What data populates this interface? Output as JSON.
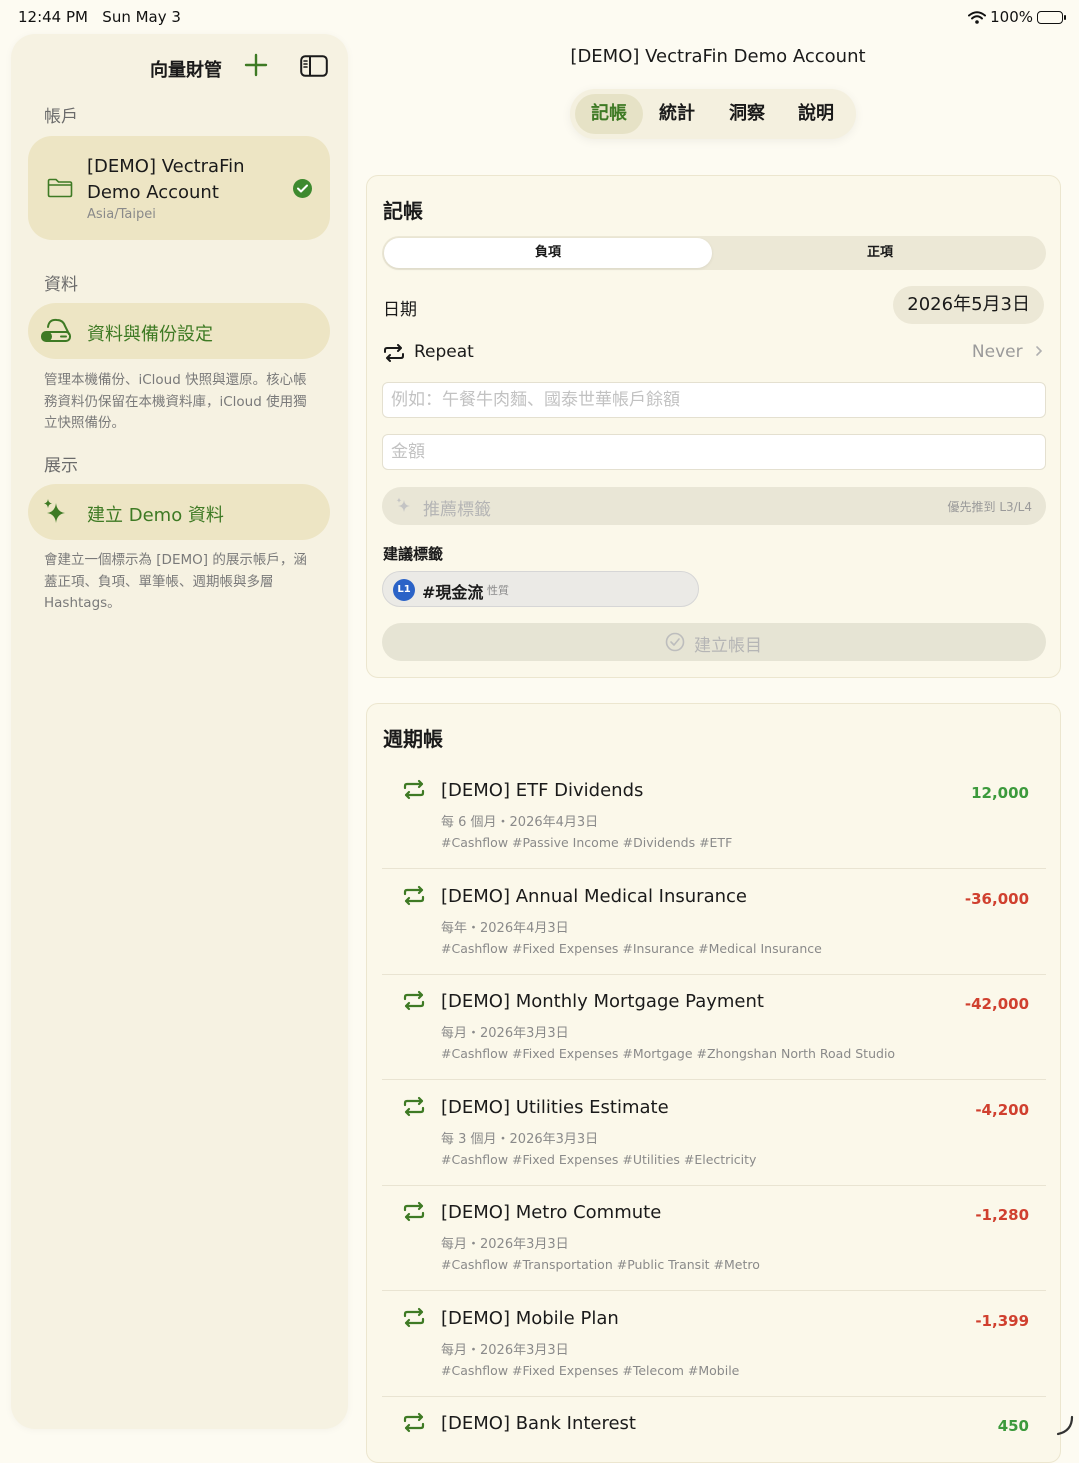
{
  "status": {
    "time": "12:44 PM",
    "date": "Sun May 3",
    "battery": "100%"
  },
  "sidebar": {
    "app_title": "向量財管",
    "accounts_header": "帳戶",
    "account": {
      "name": "[DEMO] VectraFin Demo Account",
      "timezone": "Asia/Taipei"
    },
    "data_header": "資料",
    "backup_label": "資料與備份設定",
    "backup_desc": "管理本機備份、iCloud 快照與還原。核心帳務資料仍保留在本機資料庫，iCloud 使用獨立快照備份。",
    "demo_header": "展示",
    "demo_label": "建立 Demo 資料",
    "demo_desc": "會建立一個標示為 [DEMO] 的展示帳戶，涵蓋正項、負項、單筆帳、週期帳與多層 Hashtags。"
  },
  "main": {
    "title": "[DEMO] VectraFin Demo Account",
    "tabs": [
      "記帳",
      "統計",
      "洞察",
      "說明"
    ],
    "active_tab": 0
  },
  "entry": {
    "title": "記帳",
    "segment": [
      "負項",
      "正項"
    ],
    "active_segment": 0,
    "date_label": "日期",
    "date_value": "2026年5月3日",
    "repeat_label": "Repeat",
    "repeat_value": "Never",
    "desc_placeholder": "例如：午餐牛肉麵、國泰世華帳戶餘額",
    "amount_placeholder": "金額",
    "suggest_label": "推薦標籤",
    "suggest_hint": "優先推到 L3/L4",
    "suggested_header": "建議標籤",
    "tag": {
      "level": "L1",
      "name": "#現金流",
      "type": "性質"
    },
    "create_label": "建立帳目"
  },
  "recurring": {
    "title": "週期帳",
    "items": [
      {
        "name": "[DEMO] ETF Dividends",
        "schedule": "每 6 個月・2026年4月3日",
        "tags": "#Cashflow #Passive Income #Dividends #ETF",
        "amount": "12,000",
        "sign": "pos"
      },
      {
        "name": "[DEMO] Annual Medical Insurance",
        "schedule": "每年・2026年4月3日",
        "tags": "#Cashflow #Fixed Expenses #Insurance #Medical Insurance",
        "amount": "-36,000",
        "sign": "neg"
      },
      {
        "name": "[DEMO] Monthly Mortgage Payment",
        "schedule": "每月・2026年3月3日",
        "tags": "#Cashflow #Fixed Expenses #Mortgage #Zhongshan North Road Studio",
        "amount": "-42,000",
        "sign": "neg"
      },
      {
        "name": "[DEMO] Utilities Estimate",
        "schedule": "每 3 個月・2026年3月3日",
        "tags": "#Cashflow #Fixed Expenses #Utilities #Electricity",
        "amount": "-4,200",
        "sign": "neg"
      },
      {
        "name": "[DEMO] Metro Commute",
        "schedule": "每月・2026年3月3日",
        "tags": "#Cashflow #Transportation #Public Transit #Metro",
        "amount": "-1,280",
        "sign": "neg"
      },
      {
        "name": "[DEMO] Mobile Plan",
        "schedule": "每月・2026年3月3日",
        "tags": "#Cashflow #Fixed Expenses #Telecom #Mobile",
        "amount": "-1,399",
        "sign": "neg"
      },
      {
        "name": "[DEMO] Bank Interest",
        "schedule": "",
        "tags": "",
        "amount": "450",
        "sign": "pos"
      }
    ]
  },
  "colors": {
    "accent": "#3e7a24",
    "positive": "#3c9a3c",
    "negative": "#d0402f",
    "background": "#fdfbf2"
  }
}
